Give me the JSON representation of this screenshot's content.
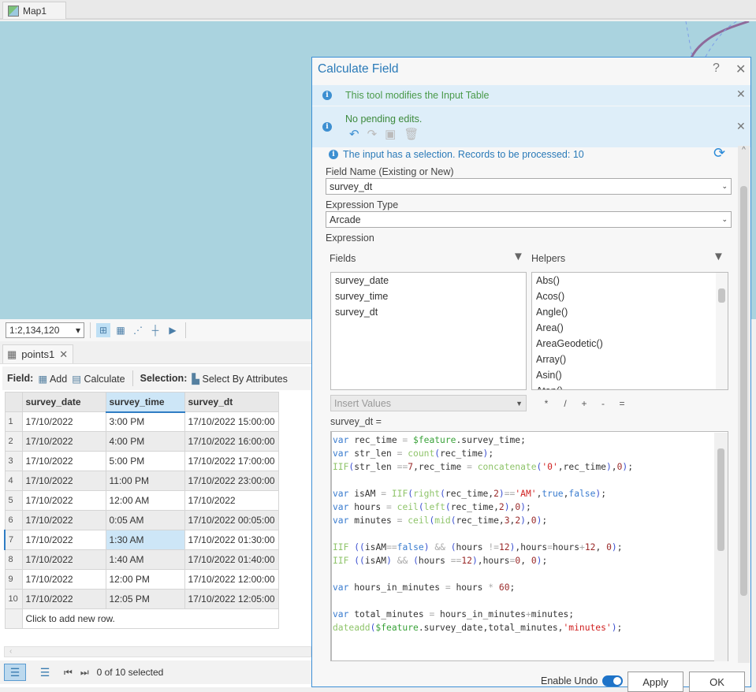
{
  "map": {
    "tab_label": "Map1",
    "scale": "1:2,134,120"
  },
  "table": {
    "tab_label": "points1",
    "toolbar": {
      "field_label": "Field:",
      "add_label": "Add",
      "calculate_label": "Calculate",
      "selection_label": "Selection:",
      "select_by_attributes_label": "Select By Attributes"
    },
    "columns": [
      "survey_date",
      "survey_time",
      "survey_dt"
    ],
    "rows": [
      [
        "1",
        "17/10/2022",
        "3:00 PM",
        "17/10/2022 15:00:00"
      ],
      [
        "2",
        "17/10/2022",
        "4:00 PM",
        "17/10/2022 16:00:00"
      ],
      [
        "3",
        "17/10/2022",
        "5:00 PM",
        "17/10/2022 17:00:00"
      ],
      [
        "4",
        "17/10/2022",
        "11:00 PM",
        "17/10/2022 23:00:00"
      ],
      [
        "5",
        "17/10/2022",
        "12:00 AM",
        "17/10/2022"
      ],
      [
        "6",
        "17/10/2022",
        "0:05 AM",
        "17/10/2022 00:05:00"
      ],
      [
        "7",
        "17/10/2022",
        "1:30 AM",
        "17/10/2022 01:30:00"
      ],
      [
        "8",
        "17/10/2022",
        "1:40 AM",
        "17/10/2022 01:40:00"
      ],
      [
        "9",
        "17/10/2022",
        "12:00 PM",
        "17/10/2022 12:00:00"
      ],
      [
        "10",
        "17/10/2022",
        "12:05 PM",
        "17/10/2022 12:05:00"
      ]
    ],
    "add_row_text": "Click to add new row.",
    "status": "0 of 10 selected"
  },
  "dialog": {
    "title": "Calculate Field",
    "help": "?",
    "info_modifies": "This tool modifies the Input Table",
    "info_edits": "No pending edits.",
    "selection_msg": "The input has a selection. Records to be processed: 10",
    "field_name_label": "Field Name (Existing or New)",
    "field_name_value": "survey_dt",
    "expression_type_label": "Expression Type",
    "expression_type_value": "Arcade",
    "expression_label": "Expression",
    "fields_label": "Fields",
    "helpers_label": "Helpers",
    "fields": [
      "survey_date",
      "survey_time",
      "survey_dt"
    ],
    "helpers": [
      "Abs()",
      "Acos()",
      "Angle()",
      "Area()",
      "AreaGeodetic()",
      "Array()",
      "Asin()",
      "Atan()"
    ],
    "insert_values_placeholder": "Insert Values",
    "operators": [
      "*",
      "/",
      "+",
      "-",
      "="
    ],
    "target_label": "survey_dt =",
    "code": [
      "var rec_time = $feature.survey_time;",
      "var str_len = count(rec_time);",
      "IIF(str_len ==7,rec_time = concatenate('0',rec_time),0);",
      "",
      "var isAM = IIF(right(rec_time,2)=='AM',true,false);",
      "var hours = ceil(left(rec_time,2),0);",
      "var minutes = ceil(mid(rec_time,3,2),0);",
      "",
      "IIF ((isAM==false) && (hours !=12),hours=hours+12, 0);",
      "IIF ((isAM) && (hours ==12),hours=0, 0);",
      "",
      "var hours_in_minutes = hours * 60;",
      "",
      "var total_minutes = hours_in_minutes+minutes;",
      "dateadd($feature.survey_date,total_minutes,'minutes');"
    ],
    "enable_undo_label": "Enable Undo",
    "enable_undo_on": true,
    "apply_label": "Apply",
    "ok_label": "OK"
  },
  "colors": {
    "accent": "#2a7ab8",
    "map_water": "#aad3df",
    "info_bg": "#deeef9"
  }
}
